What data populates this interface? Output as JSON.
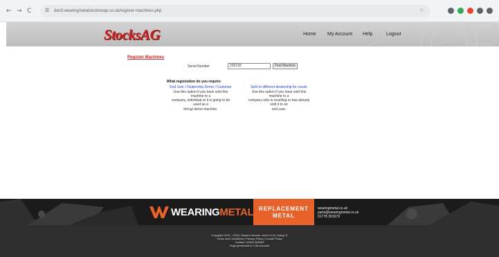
{
  "browser": {
    "back_glyph": "←",
    "forward_glyph": "→",
    "reload_glyph": "C",
    "site_info_glyph": "☰",
    "url": "dev3.wearingmetalstockswap.co.uk/register-machines.php",
    "bookmark_glyph": "☆",
    "tab_glyph": "▢",
    "extension_colors": [
      "#5f6368",
      "#34a853",
      "#ea4335",
      "#5f6368",
      "#5f6368",
      "#34a853"
    ]
  },
  "header": {
    "logo": "StocksAG",
    "nav": [
      "Home",
      "My Account",
      "Help",
      "Logout"
    ]
  },
  "main": {
    "title": "Register Machines",
    "serial_label": "Serial Number",
    "serial_value": "232132",
    "find_button": "Find Machine",
    "question": "What registration do you require:",
    "options": [
      {
        "link": "End User / Dealership Demo / Customer",
        "desc": [
          "Use this option if you have sold this machine to a",
          "company, individual or it is going to be used as a",
          "hiring/ demo machine."
        ]
      },
      {
        "link": "Sold to different dealership for resale",
        "desc": [
          "Use this option if you have sold this machine to a",
          "company who is reselling or has already sold it to an",
          "end user."
        ]
      }
    ]
  },
  "banner": {
    "brand_white": "WEARING",
    "brand_orange": "METAL",
    "replacement": [
      "REPLACEMENT",
      "METAL"
    ],
    "contact": [
      "wearingmetal.co.uk",
      "parts@wearingmetal.co.uk",
      "01778 301679"
    ],
    "accent": "#e8622c"
  },
  "footer": {
    "lines": [
      "Copyright 2010 - 2024 | System Version: dev2 6.4.8 | Using: S",
      "Terms and Conditions | Privacy Policy | Cookie Policy",
      "Contact: 01945 464509",
      "Page generated in 0.28 seconds"
    ]
  }
}
